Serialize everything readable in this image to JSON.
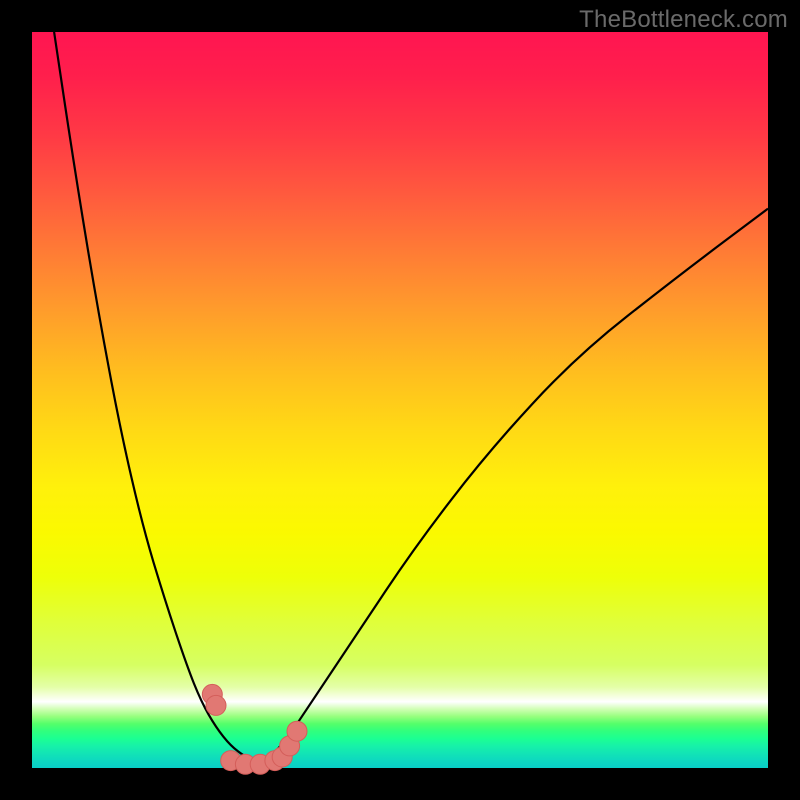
{
  "watermark": "TheBottleneck.com",
  "colors": {
    "background": "#000000",
    "gradient_top": "#ff1551",
    "gradient_mid": "#fff10b",
    "gradient_bottom": "#09cec7",
    "curve_stroke": "#000000",
    "marker_fill": "#e17873",
    "marker_stroke": "#d45e5a"
  },
  "chart_data": {
    "type": "line",
    "title": "",
    "xlabel": "",
    "ylabel": "",
    "xlim": [
      0,
      100
    ],
    "ylim": [
      0,
      100
    ],
    "series": [
      {
        "name": "left-curve",
        "x": [
          3,
          6,
          9,
          12,
          15,
          18,
          21,
          23,
          25,
          27,
          29,
          31
        ],
        "y": [
          100,
          80,
          62,
          46,
          33,
          23,
          14,
          9,
          5.5,
          3,
          1.5,
          0.5
        ]
      },
      {
        "name": "right-curve",
        "x": [
          31,
          34,
          38,
          44,
          52,
          62,
          74,
          88,
          100
        ],
        "y": [
          0.5,
          3,
          9,
          18,
          30,
          43,
          56,
          67,
          76
        ]
      }
    ],
    "markers": {
      "name": "highlight-points",
      "x": [
        24.5,
        25,
        27,
        29,
        31,
        33,
        34,
        35,
        36
      ],
      "y": [
        10,
        8.5,
        1,
        0.5,
        0.5,
        1,
        1.5,
        3,
        5
      ]
    }
  }
}
